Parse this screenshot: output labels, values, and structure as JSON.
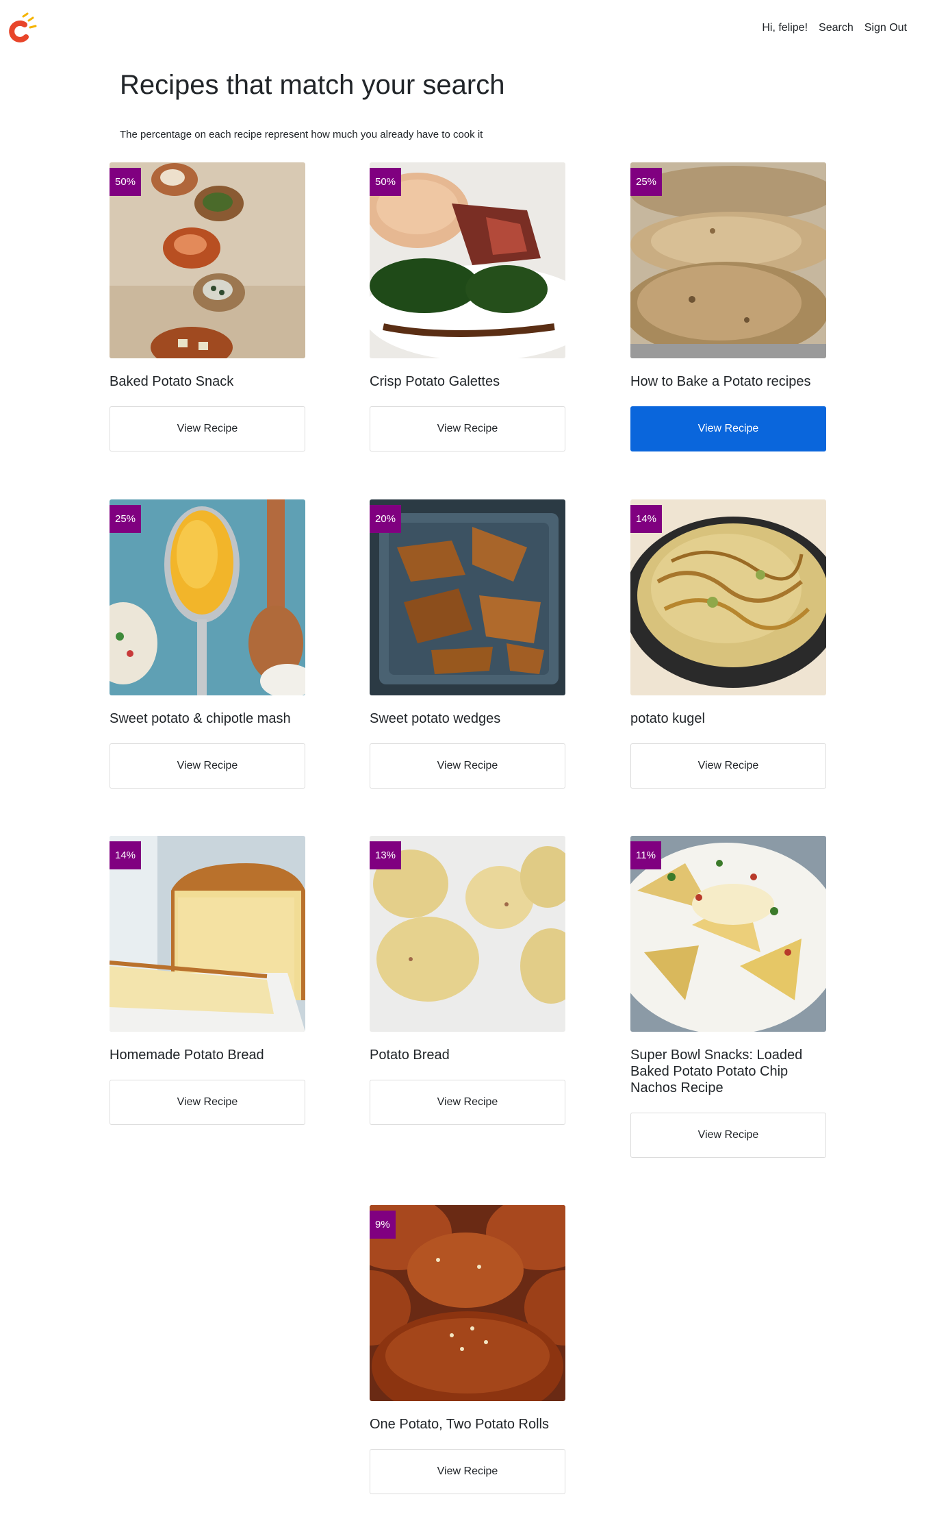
{
  "header": {
    "logo_icon": "magnet-icon",
    "nav": [
      {
        "label": "Hi, felipe!"
      },
      {
        "label": "Search"
      },
      {
        "label": "Sign Out"
      }
    ]
  },
  "page": {
    "title": "Recipes that match your search",
    "subtitle": "The percentage on each recipe represent how much you already have to cook it"
  },
  "recipes": [
    {
      "name": "Baked Potato Snack",
      "percent": "50%",
      "button": "View Recipe"
    },
    {
      "name": "Crisp Potato Galettes",
      "percent": "50%",
      "button": "View Recipe"
    },
    {
      "name": "How to Bake a Potato recipes",
      "percent": "25%",
      "button": "View Recipe"
    },
    {
      "name": "Sweet potato & chipotle mash",
      "percent": "25%",
      "button": "View Recipe"
    },
    {
      "name": "Sweet potato wedges",
      "percent": "20%",
      "button": "View Recipe"
    },
    {
      "name": "potato kugel",
      "percent": "14%",
      "button": "View Recipe"
    },
    {
      "name": "Homemade Potato Bread",
      "percent": "14%",
      "button": "View Recipe"
    },
    {
      "name": "Potato Bread",
      "percent": "13%",
      "button": "View Recipe"
    },
    {
      "name": "Super Bowl Snacks: Loaded Baked Potato Potato Chip Nachos Recipe",
      "percent": "11%",
      "button": "View Recipe"
    },
    {
      "name": "One Potato, Two Potato Rolls",
      "percent": "9%",
      "button": "View Recipe"
    }
  ],
  "colors": {
    "badge": "#800080",
    "accent": "#0a66dc"
  }
}
